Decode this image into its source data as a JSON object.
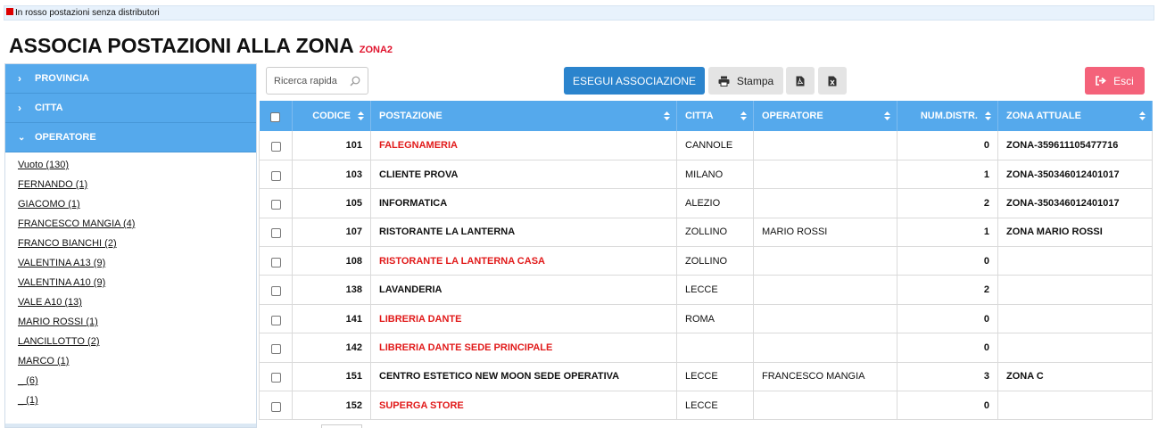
{
  "legend": {
    "text": "In rosso postazioni senza distributori",
    "color": "#dd0000"
  },
  "title": {
    "main": "ASSOCIA POSTAZIONI ALLA ZONA",
    "zone": "ZONA2"
  },
  "sidebar": {
    "sections": [
      {
        "label": "PROVINCIA",
        "icon": "chevron-right-icon"
      },
      {
        "label": "CITTA",
        "icon": "chevron-right-icon"
      },
      {
        "label": "OPERATORE",
        "icon": "chevron-down-icon"
      }
    ],
    "operators": [
      "Vuoto (130)",
      "FERNANDO (1)",
      "GIACOMO (1)",
      "FRANCESCO MANGIA (4)",
      "FRANCO BIANCHI (2)",
      "VALENTINA A13 (9)",
      "VALENTINA A10 (9)",
      "VALE A10 (13)",
      "MARIO ROSSI (1)",
      "LANCILLOTTO (2)",
      "MARCO (1)",
      "_ (6)",
      "_ (1)"
    ]
  },
  "toolbar": {
    "search_placeholder": "Ricerca rapida",
    "run_label": "ESEGUI ASSOCIAZIONE",
    "print_label": "Stampa",
    "exit_label": "Esci",
    "primary_color": "#2b84cd",
    "exit_color": "#f4627a"
  },
  "table": {
    "columns": [
      "CODICE",
      "POSTAZIONE",
      "CITTA",
      "OPERATORE",
      "NUM.DISTR.",
      "ZONA ATTUALE"
    ],
    "rows": [
      {
        "codice": "101",
        "postazione": "FALEGNAMERIA",
        "citta": "CANNOLE",
        "operatore": "",
        "num": "0",
        "zona": "ZONA-359611105477716",
        "red": true
      },
      {
        "codice": "103",
        "postazione": "CLIENTE PROVA",
        "citta": "MILANO",
        "operatore": "",
        "num": "1",
        "zona": "ZONA-350346012401017",
        "red": false
      },
      {
        "codice": "105",
        "postazione": "INFORMATICA",
        "citta": "ALEZIO",
        "operatore": "",
        "num": "2",
        "zona": "ZONA-350346012401017",
        "red": false
      },
      {
        "codice": "107",
        "postazione": "RISTORANTE LA LANTERNA",
        "citta": "ZOLLINO",
        "operatore": "MARIO ROSSI",
        "num": "1",
        "zona": "ZONA MARIO ROSSI",
        "red": false
      },
      {
        "codice": "108",
        "postazione": "RISTORANTE LA LANTERNA CASA",
        "citta": "ZOLLINO",
        "operatore": "",
        "num": "0",
        "zona": "",
        "red": true
      },
      {
        "codice": "138",
        "postazione": "LAVANDERIA",
        "citta": "LECCE",
        "operatore": "",
        "num": "2",
        "zona": "",
        "red": false
      },
      {
        "codice": "141",
        "postazione": "LIBRERIA DANTE",
        "citta": "ROMA",
        "operatore": "",
        "num": "0",
        "zona": "",
        "red": true
      },
      {
        "codice": "142",
        "postazione": "LIBRERIA DANTE SEDE PRINCIPALE",
        "citta": "",
        "operatore": "",
        "num": "0",
        "zona": "",
        "red": true
      },
      {
        "codice": "151",
        "postazione": "CENTRO ESTETICO NEW MOON SEDE OPERATIVA",
        "citta": "LECCE",
        "operatore": "FRANCESCO MANGIA",
        "num": "3",
        "zona": "ZONA C",
        "red": false
      },
      {
        "codice": "152",
        "postazione": "SUPERGA STORE",
        "citta": "LECCE",
        "operatore": "",
        "num": "0",
        "zona": "",
        "red": true
      }
    ]
  }
}
